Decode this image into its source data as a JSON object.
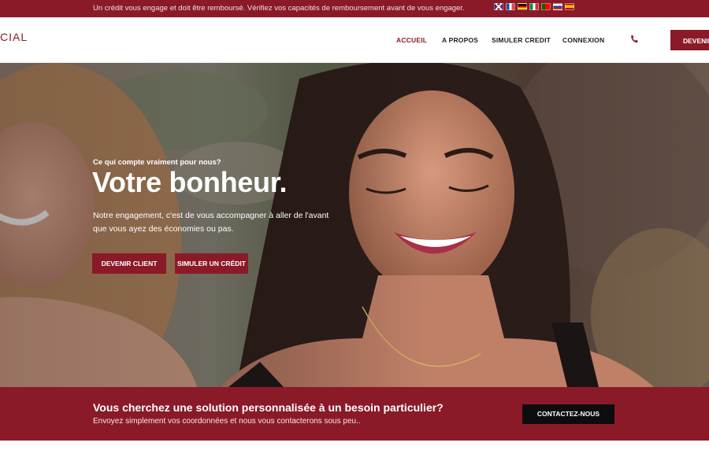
{
  "topbar": {
    "notice": "Un crédit vous engage et doit être remboursé. Vérifiez vos capacités de remboursement avant de vous engager.",
    "languages": [
      "en",
      "fr",
      "de",
      "it",
      "pt",
      "ru",
      "es"
    ]
  },
  "header": {
    "logo_text": "CIAL",
    "nav": [
      {
        "label": "ACCUEIL",
        "active": true
      },
      {
        "label": "A PROPOS",
        "active": false
      },
      {
        "label": "SIMULER CREDIT",
        "active": false
      },
      {
        "label": "CONNEXION",
        "active": false
      }
    ],
    "phone_icon": "phone-icon",
    "cta_label": "DEVENIR"
  },
  "hero": {
    "eyebrow": "Ce qui compte vraiment pour nous?",
    "title": "Votre bonheur.",
    "description_line1": "Notre engagement, c'est de vous accompagner à aller de l'avant",
    "description_line2": "que vous ayez des économies ou pas.",
    "primary_button": "DEVENIR CLIENT",
    "secondary_button": "SIMULER UN CRÉDIT"
  },
  "cta_band": {
    "title": "Vous cherchez une solution personnalisée à un besoin particulier?",
    "subtitle": "Envoyez simplement vos coordonnées et nous vous contacterons sous peu..",
    "button": "CONTACTEZ-NOUS"
  },
  "colors": {
    "brand": "#8b1a28",
    "dark_button": "#0d0d0d",
    "text_dark": "#1f1f1f"
  }
}
